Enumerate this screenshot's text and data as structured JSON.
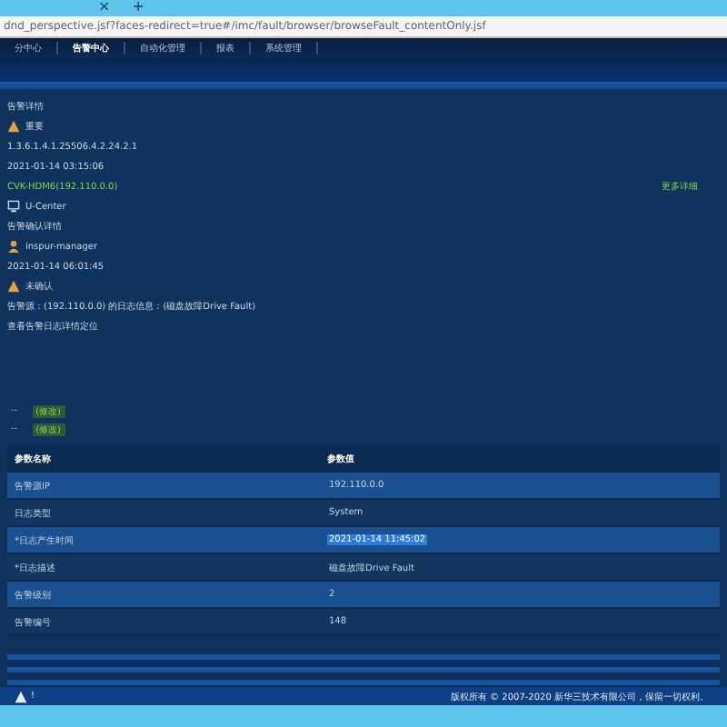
{
  "browser": {
    "tabs": [
      {
        "label": "×"
      },
      {
        "label": "+"
      }
    ],
    "url": "dnd_perspective.jsf?faces-redirect=true#/imc/fault/browser/browseFault_contentOnly.jsf"
  },
  "nav": [
    {
      "label": "分中心",
      "selected": false
    },
    {
      "label": "告警中心",
      "selected": true
    },
    {
      "label": "自动化管理",
      "selected": false
    },
    {
      "label": "报表",
      "selected": false
    },
    {
      "label": "系统管理",
      "selected": false
    }
  ],
  "detail": {
    "title": "告警详情",
    "level": "重要",
    "oid": "1.3.6.1.4.1.25506.4.2.24.2.1",
    "time": "2021-01-14 03:15:06",
    "device_link": "CVK-HDM6(192.110.0.0)",
    "more_link": "更多详细",
    "source": "U-Center",
    "ack_title": "告警确认详情",
    "ack_user": "inspur-manager",
    "ack_time": "2021-01-14 06:01:45",
    "ack_state": "未确认",
    "message": "告警源：(192.110.0.0) 的日志信息：(磁盘故障Drive Fault)",
    "hint": "查看告警日志详情定位"
  },
  "edits": [
    {
      "dash": "--",
      "action": "(修改)"
    },
    {
      "dash": "--",
      "action": "(修改)"
    }
  ],
  "table": {
    "columns": [
      "参数名称",
      "参数值"
    ],
    "rows": [
      {
        "name": "告警源IP",
        "value": "192.110.0.0",
        "highlighted": false
      },
      {
        "name": "日志类型",
        "value": "System",
        "highlighted": false
      },
      {
        "name": "*日志产生时间",
        "value": "2021-01-14 11:45:02",
        "highlighted": true
      },
      {
        "name": "*日志描述",
        "value": "磁盘故障Drive Fault",
        "highlighted": false
      },
      {
        "name": "告警级别",
        "value": "2",
        "highlighted": false
      },
      {
        "name": "告警编号",
        "value": "148",
        "highlighted": false
      }
    ]
  },
  "status_bar": {
    "alert": "!",
    "copyright": "版权所有 © 2007-2020 新华三技术有限公司，保留一切权利。"
  }
}
